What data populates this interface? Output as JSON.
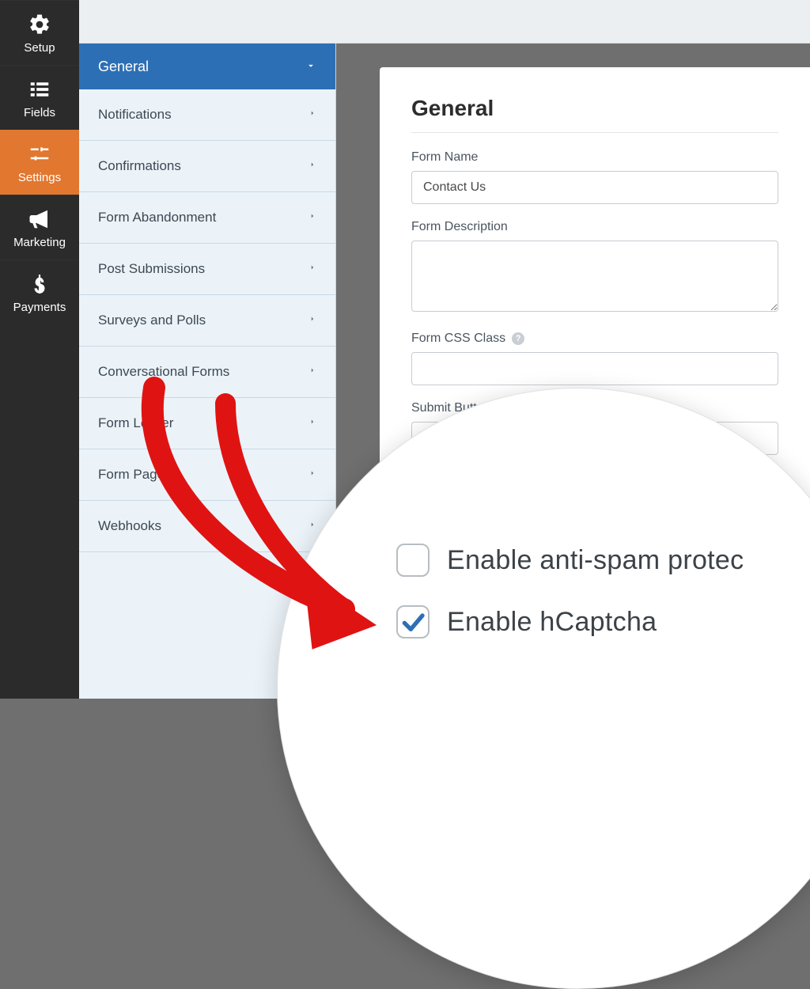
{
  "iconbar": {
    "items": [
      {
        "label": "Setup"
      },
      {
        "label": "Fields"
      },
      {
        "label": "Settings"
      },
      {
        "label": "Marketing"
      },
      {
        "label": "Payments"
      }
    ],
    "activeIndex": 2
  },
  "sidepanel": {
    "header": "General",
    "rows": [
      "Notifications",
      "Confirmations",
      "Form Abandonment",
      "Post Submissions",
      "Surveys and Polls",
      "Conversational Forms",
      "Form Locker",
      "Form Pages",
      "Webhooks"
    ]
  },
  "card": {
    "title": "General",
    "formNameLabel": "Form Name",
    "formNameValue": "Contact Us",
    "formDescLabel": "Form Description",
    "formDescValue": "",
    "formCssLabel": "Form CSS Class",
    "formCssValue": "",
    "submitBtnLabel": "Submit Button Text",
    "submitBtnPartial": "Sub"
  },
  "zoom": {
    "antiSpam": {
      "label": "Enable anti-spam protec",
      "checked": false
    },
    "hcaptcha": {
      "label": "Enable hCaptcha",
      "checked": true
    }
  }
}
